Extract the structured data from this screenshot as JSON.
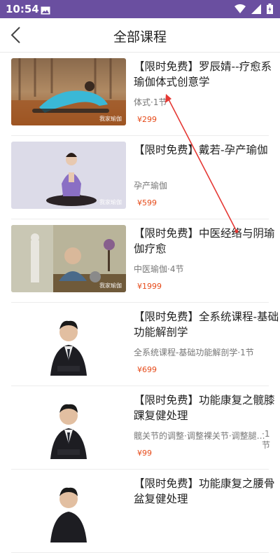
{
  "status_bar": {
    "time": "10:54",
    "bg_color": "#6a4fa0",
    "icons": [
      "image-icon",
      "wifi-icon",
      "signal-icon",
      "battery-icon"
    ]
  },
  "header": {
    "title": "全部课程",
    "back_icon": "chevron-left-icon"
  },
  "courses": [
    {
      "title": "【限时免费】罗辰婧--疗愈系瑜伽体式创意学",
      "subtitle": "体式·1节",
      "subtitle_extra": "",
      "price": "¥299",
      "watermark": "我家瑜伽"
    },
    {
      "title": "【限时免费】戴若-孕产瑜伽",
      "subtitle": "孕产瑜伽",
      "subtitle_extra": "",
      "price": "¥599",
      "watermark": "我家瑜伽"
    },
    {
      "title": "【限时免费】中医经络与阴瑜伽疗愈",
      "subtitle": "中医瑜伽·4节",
      "subtitle_extra": "",
      "price": "¥1999",
      "watermark": "我家瑜伽"
    },
    {
      "title": "【限时免费】全系统课程-基础功能解剖学",
      "subtitle": "全系统课程-基础功能解剖学·1节",
      "subtitle_extra": "",
      "price": "¥699",
      "watermark": ""
    },
    {
      "title": "【限时免费】功能康复之髋膝踝复健处理",
      "subtitle": "髋关节的调整·调整裸关节·调整腿部...",
      "subtitle_extra": "·1节",
      "price": "¥99",
      "watermark": ""
    },
    {
      "title": "【限时免费】功能康复之腰骨盆复健处理",
      "subtitle": "",
      "subtitle_extra": "",
      "price": "",
      "watermark": ""
    }
  ],
  "accent_color": "#e64a19"
}
